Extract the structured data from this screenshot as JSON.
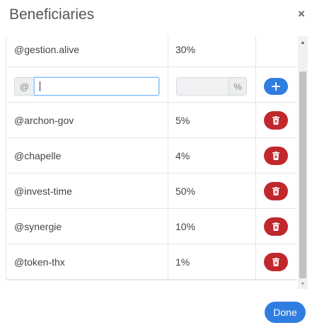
{
  "modal": {
    "title": "Beneficiaries",
    "close_label": "×",
    "done_label": "Done"
  },
  "first_row": {
    "name": "@gestion.alive",
    "pct": "30%"
  },
  "input_row": {
    "at_prefix": "@",
    "name_value": "",
    "pct_value": "",
    "pct_suffix": "%",
    "add_icon": "plus-icon"
  },
  "beneficiaries": [
    {
      "name": "@archon-gov",
      "pct": "5%"
    },
    {
      "name": "@chapelle",
      "pct": "4%"
    },
    {
      "name": "@invest-time",
      "pct": "50%"
    },
    {
      "name": "@synergie",
      "pct": "10%"
    },
    {
      "name": "@token-thx",
      "pct": "1%"
    }
  ],
  "icons": {
    "delete": "trash-icon"
  },
  "colors": {
    "primary": "#2f7de1",
    "danger": "#c0282d",
    "focus_border": "#80bdff"
  }
}
